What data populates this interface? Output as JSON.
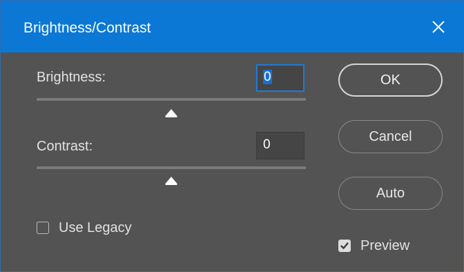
{
  "window": {
    "title": "Brightness/Contrast"
  },
  "brightness": {
    "label": "Brightness:",
    "value": "0",
    "slider_fraction": 0.5
  },
  "contrast": {
    "label": "Contrast:",
    "value": "0",
    "slider_fraction": 0.5
  },
  "buttons": {
    "ok_label": "OK",
    "cancel_label": "Cancel",
    "auto_label": "Auto"
  },
  "options": {
    "use_legacy_label": "Use Legacy",
    "use_legacy_checked": false,
    "preview_label": "Preview",
    "preview_checked": true
  },
  "colors": {
    "titlebar": "#0b78d6",
    "panel": "#535353",
    "accent": "#1c7be0"
  },
  "icons": {
    "close": "close-icon",
    "slider_thumb": "triangle-thumb-icon",
    "check": "checkmark-icon"
  }
}
